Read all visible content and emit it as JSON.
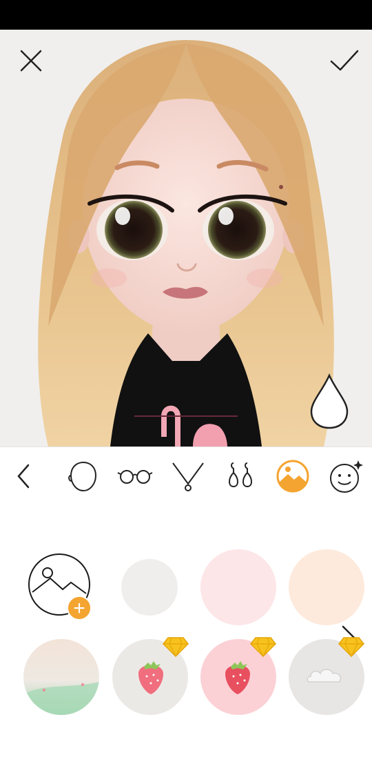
{
  "editor": {
    "close_icon": "close-icon",
    "confirm_icon": "checkmark-icon",
    "color_tool_icon": "color-drop-icon"
  },
  "toolbar": {
    "items": [
      {
        "icon": "back-chevron-icon"
      },
      {
        "icon": "face-shape-icon"
      },
      {
        "icon": "glasses-icon"
      },
      {
        "icon": "necklace-icon"
      },
      {
        "icon": "earrings-icon"
      },
      {
        "icon": "background-icon",
        "selected": true
      },
      {
        "icon": "face-sparkle-icon"
      }
    ],
    "accent": "#f4a430"
  },
  "backgrounds": {
    "items": [
      {
        "kind": "custom",
        "icon": "add-image-icon"
      },
      {
        "kind": "solid",
        "color": "#efeeec"
      },
      {
        "kind": "solid",
        "color": "#fde6e8"
      },
      {
        "kind": "solid",
        "color": "#fdeadc",
        "selected": true
      },
      {
        "kind": "gradient",
        "colors": [
          "#f3e3d8",
          "#9fd3b0"
        ]
      },
      {
        "kind": "pattern",
        "name": "strawberry",
        "color": "#ebe9e5",
        "premium": true
      },
      {
        "kind": "pattern",
        "name": "strawberry",
        "color": "#fbd1d6",
        "premium": true
      },
      {
        "kind": "pattern",
        "name": "cloud",
        "color": "#e7e6e4",
        "premium": true
      }
    ],
    "premium_icon": "diamond-icon",
    "more_icon": "chevron-right-icon"
  }
}
